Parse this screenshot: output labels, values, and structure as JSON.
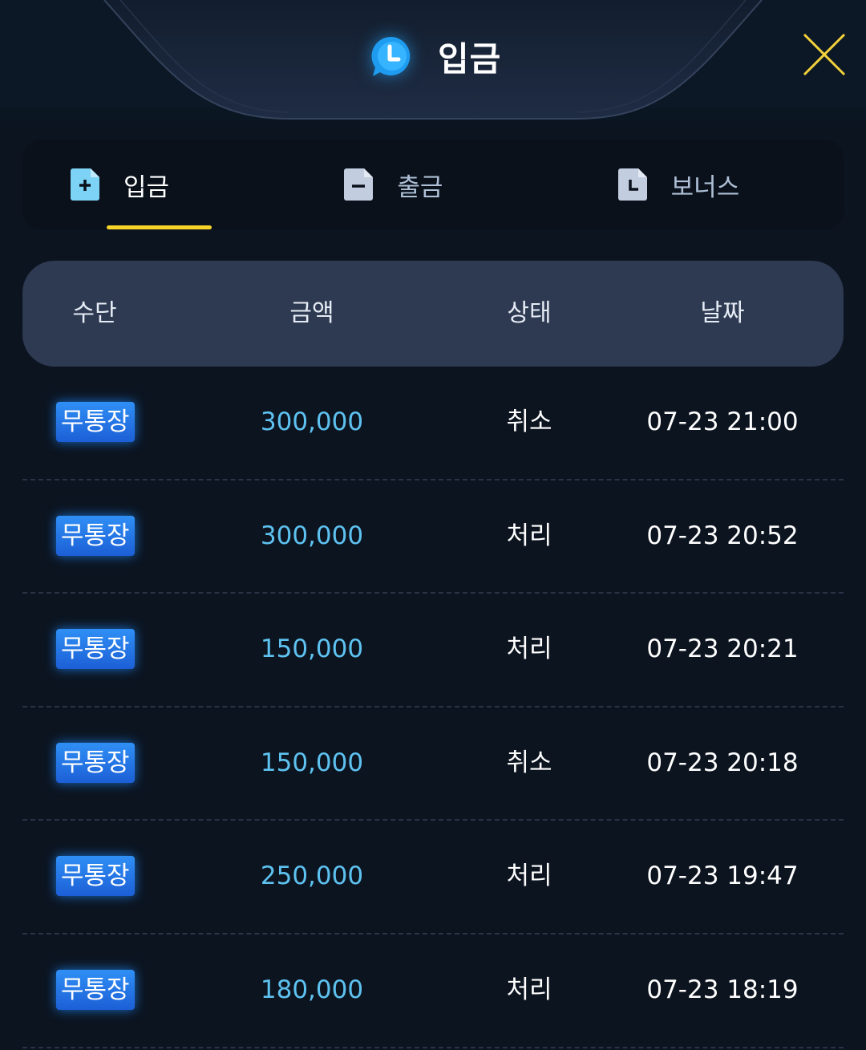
{
  "header": {
    "title": "입금",
    "title_icon": "clock-chat-icon",
    "close_icon": "close-icon"
  },
  "tabs": [
    {
      "label": "입금",
      "icon": "plus-document-icon",
      "active": true
    },
    {
      "label": "출금",
      "icon": "minus-document-icon",
      "active": false
    },
    {
      "label": "보너스",
      "icon": "clock-document-icon",
      "active": false
    }
  ],
  "table": {
    "columns": [
      "수단",
      "금액",
      "상태",
      "날짜"
    ],
    "rows": [
      {
        "method": "무통장",
        "amount": "300,000",
        "status": "취소",
        "date": "07-23 21:00"
      },
      {
        "method": "무통장",
        "amount": "300,000",
        "status": "처리",
        "date": "07-23 20:52"
      },
      {
        "method": "무통장",
        "amount": "150,000",
        "status": "처리",
        "date": "07-23 20:21"
      },
      {
        "method": "무통장",
        "amount": "150,000",
        "status": "취소",
        "date": "07-23 20:18"
      },
      {
        "method": "무통장",
        "amount": "250,000",
        "status": "처리",
        "date": "07-23 19:47"
      },
      {
        "method": "무통장",
        "amount": "180,000",
        "status": "처리",
        "date": "07-23 18:19"
      }
    ]
  },
  "colors": {
    "accent_underline": "#f6d42a",
    "close_icon": "#f3d23a",
    "amount_text": "#5ec2f0",
    "badge": "#2a7ae8",
    "table_header_bg": "#2e3a52",
    "background": "#0c1420"
  }
}
